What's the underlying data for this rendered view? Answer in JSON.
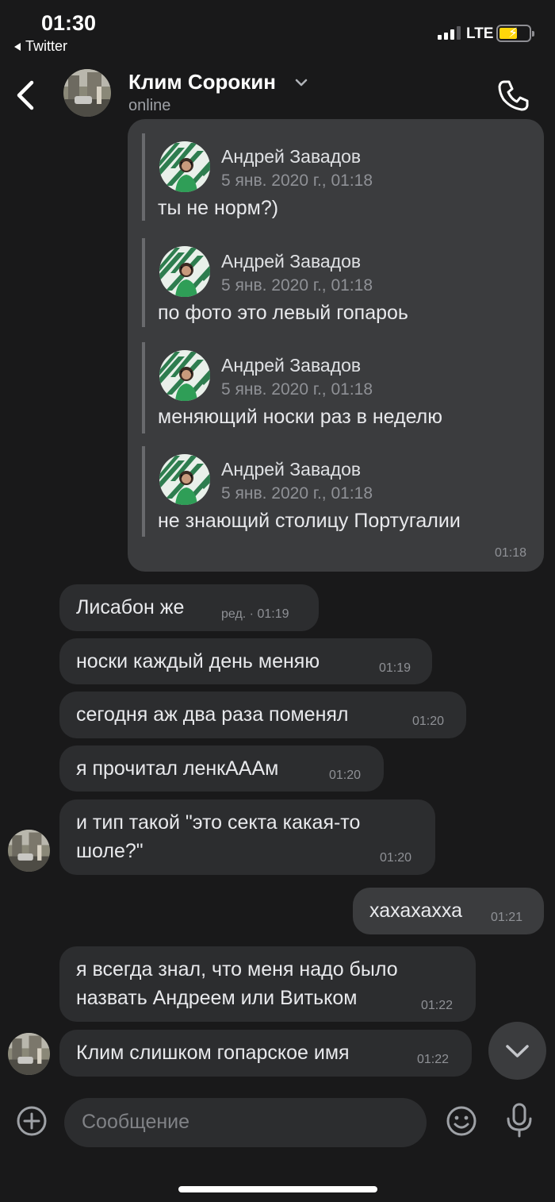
{
  "status_bar": {
    "time": "01:30",
    "back_app": "Twitter",
    "network": "LTE"
  },
  "header": {
    "name": "Клим Сорокин",
    "status": "online"
  },
  "forwarded": {
    "items": [
      {
        "author": "Андрей Завадов",
        "date": "5 янв. 2020 г., 01:18",
        "text": "ты не норм?)"
      },
      {
        "author": "Андрей Завадов",
        "date": "5 янв. 2020 г., 01:18",
        "text": "по фото это левый гопароь"
      },
      {
        "author": "Андрей Завадов",
        "date": "5 янв. 2020 г., 01:18",
        "text": "меняющий носки раз в неделю"
      },
      {
        "author": "Андрей Завадов",
        "date": "5 янв. 2020 г., 01:18",
        "text": "не знающий столицу Португалии"
      }
    ],
    "time": "01:18"
  },
  "messages": [
    {
      "direction": "in",
      "lines": [
        "Лисабон же"
      ],
      "time": "ред. · 01:19"
    },
    {
      "direction": "in",
      "lines": [
        "носки каждый день меняю"
      ],
      "time": "01:19"
    },
    {
      "direction": "in",
      "lines": [
        "сегодня аж два раза поменял"
      ],
      "time": "01:20"
    },
    {
      "direction": "in",
      "lines": [
        "я прочитал ленкАААм"
      ],
      "time": "01:20"
    },
    {
      "direction": "in",
      "lines": [
        "и тип такой \"это секта какая-то",
        "шоле?\""
      ],
      "time": "01:20"
    },
    {
      "direction": "out",
      "lines": [
        "хахахахха"
      ],
      "time": "01:21"
    },
    {
      "direction": "in",
      "lines": [
        "я всегда знал, что меня надо было",
        "назвать Андреем или Витьком"
      ],
      "time": "01:22"
    },
    {
      "direction": "in",
      "lines": [
        "Клим слишком гопарское имя"
      ],
      "time": "01:22"
    }
  ],
  "composer": {
    "placeholder": "Сообщение"
  },
  "icons": {
    "back": "chevron-left-icon",
    "call": "phone-icon",
    "add": "plus-circle-icon",
    "emoji": "smile-icon",
    "mic": "microphone-icon",
    "scroll": "chevron-down-icon"
  },
  "colors": {
    "background": "#19191a",
    "incoming_bubble": "#2c2d2f",
    "outgoing_bubble": "#3b3c3e",
    "battery": "#ffd60a"
  }
}
